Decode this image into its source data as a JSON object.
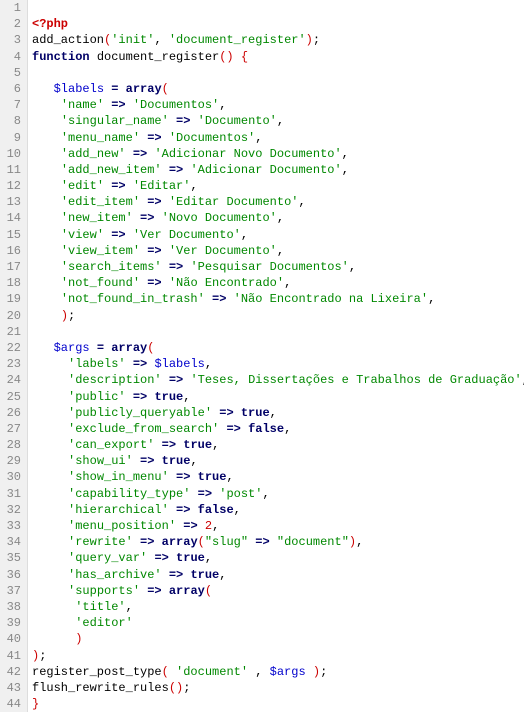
{
  "line_start": 1,
  "line_end": 44,
  "tokens": [
    [],
    [
      {
        "t": "<?php",
        "c": "tag"
      }
    ],
    [
      {
        "t": "add_action",
        "c": "fn"
      },
      {
        "t": "(",
        "c": "paren"
      },
      {
        "t": "'init'",
        "c": "str"
      },
      {
        "t": ", ",
        "c": "plain"
      },
      {
        "t": "'document_register'",
        "c": "str"
      },
      {
        "t": ")",
        "c": "paren"
      },
      {
        "t": ";",
        "c": "plain"
      }
    ],
    [
      {
        "t": "function",
        "c": "kw"
      },
      {
        "t": " ",
        "c": "plain"
      },
      {
        "t": "document_register",
        "c": "fn"
      },
      {
        "t": "()",
        "c": "paren"
      },
      {
        "t": " ",
        "c": "plain"
      },
      {
        "t": "{",
        "c": "paren"
      }
    ],
    [],
    [
      {
        "t": "   ",
        "c": "plain"
      },
      {
        "t": "$labels",
        "c": "var"
      },
      {
        "t": " ",
        "c": "plain"
      },
      {
        "t": "=",
        "c": "op"
      },
      {
        "t": " ",
        "c": "plain"
      },
      {
        "t": "array",
        "c": "kw"
      },
      {
        "t": "(",
        "c": "paren"
      }
    ],
    [
      {
        "t": "    ",
        "c": "plain"
      },
      {
        "t": "'name'",
        "c": "str"
      },
      {
        "t": " ",
        "c": "plain"
      },
      {
        "t": "=>",
        "c": "op"
      },
      {
        "t": " ",
        "c": "plain"
      },
      {
        "t": "'Documentos'",
        "c": "str"
      },
      {
        "t": ",",
        "c": "plain"
      }
    ],
    [
      {
        "t": "    ",
        "c": "plain"
      },
      {
        "t": "'singular_name'",
        "c": "str"
      },
      {
        "t": " ",
        "c": "plain"
      },
      {
        "t": "=>",
        "c": "op"
      },
      {
        "t": " ",
        "c": "plain"
      },
      {
        "t": "'Documento'",
        "c": "str"
      },
      {
        "t": ",",
        "c": "plain"
      }
    ],
    [
      {
        "t": "    ",
        "c": "plain"
      },
      {
        "t": "'menu_name'",
        "c": "str"
      },
      {
        "t": " ",
        "c": "plain"
      },
      {
        "t": "=>",
        "c": "op"
      },
      {
        "t": " ",
        "c": "plain"
      },
      {
        "t": "'Documentos'",
        "c": "str"
      },
      {
        "t": ",",
        "c": "plain"
      }
    ],
    [
      {
        "t": "    ",
        "c": "plain"
      },
      {
        "t": "'add_new'",
        "c": "str"
      },
      {
        "t": " ",
        "c": "plain"
      },
      {
        "t": "=>",
        "c": "op"
      },
      {
        "t": " ",
        "c": "plain"
      },
      {
        "t": "'Adicionar Novo Documento'",
        "c": "str"
      },
      {
        "t": ",",
        "c": "plain"
      }
    ],
    [
      {
        "t": "    ",
        "c": "plain"
      },
      {
        "t": "'add_new_item'",
        "c": "str"
      },
      {
        "t": " ",
        "c": "plain"
      },
      {
        "t": "=>",
        "c": "op"
      },
      {
        "t": " ",
        "c": "plain"
      },
      {
        "t": "'Adicionar Documento'",
        "c": "str"
      },
      {
        "t": ",",
        "c": "plain"
      }
    ],
    [
      {
        "t": "    ",
        "c": "plain"
      },
      {
        "t": "'edit'",
        "c": "str"
      },
      {
        "t": " ",
        "c": "plain"
      },
      {
        "t": "=>",
        "c": "op"
      },
      {
        "t": " ",
        "c": "plain"
      },
      {
        "t": "'Editar'",
        "c": "str"
      },
      {
        "t": ",",
        "c": "plain"
      }
    ],
    [
      {
        "t": "    ",
        "c": "plain"
      },
      {
        "t": "'edit_item'",
        "c": "str"
      },
      {
        "t": " ",
        "c": "plain"
      },
      {
        "t": "=>",
        "c": "op"
      },
      {
        "t": " ",
        "c": "plain"
      },
      {
        "t": "'Editar Documento'",
        "c": "str"
      },
      {
        "t": ",",
        "c": "plain"
      }
    ],
    [
      {
        "t": "    ",
        "c": "plain"
      },
      {
        "t": "'new_item'",
        "c": "str"
      },
      {
        "t": " ",
        "c": "plain"
      },
      {
        "t": "=>",
        "c": "op"
      },
      {
        "t": " ",
        "c": "plain"
      },
      {
        "t": "'Novo Documento'",
        "c": "str"
      },
      {
        "t": ",",
        "c": "plain"
      }
    ],
    [
      {
        "t": "    ",
        "c": "plain"
      },
      {
        "t": "'view'",
        "c": "str"
      },
      {
        "t": " ",
        "c": "plain"
      },
      {
        "t": "=>",
        "c": "op"
      },
      {
        "t": " ",
        "c": "plain"
      },
      {
        "t": "'Ver Documento'",
        "c": "str"
      },
      {
        "t": ",",
        "c": "plain"
      }
    ],
    [
      {
        "t": "    ",
        "c": "plain"
      },
      {
        "t": "'view_item'",
        "c": "str"
      },
      {
        "t": " ",
        "c": "plain"
      },
      {
        "t": "=>",
        "c": "op"
      },
      {
        "t": " ",
        "c": "plain"
      },
      {
        "t": "'Ver Documento'",
        "c": "str"
      },
      {
        "t": ",",
        "c": "plain"
      }
    ],
    [
      {
        "t": "    ",
        "c": "plain"
      },
      {
        "t": "'search_items'",
        "c": "str"
      },
      {
        "t": " ",
        "c": "plain"
      },
      {
        "t": "=>",
        "c": "op"
      },
      {
        "t": " ",
        "c": "plain"
      },
      {
        "t": "'Pesquisar Documentos'",
        "c": "str"
      },
      {
        "t": ",",
        "c": "plain"
      }
    ],
    [
      {
        "t": "    ",
        "c": "plain"
      },
      {
        "t": "'not_found'",
        "c": "str"
      },
      {
        "t": " ",
        "c": "plain"
      },
      {
        "t": "=>",
        "c": "op"
      },
      {
        "t": " ",
        "c": "plain"
      },
      {
        "t": "'Não Encontrado'",
        "c": "str"
      },
      {
        "t": ",",
        "c": "plain"
      }
    ],
    [
      {
        "t": "    ",
        "c": "plain"
      },
      {
        "t": "'not_found_in_trash'",
        "c": "str"
      },
      {
        "t": " ",
        "c": "plain"
      },
      {
        "t": "=>",
        "c": "op"
      },
      {
        "t": " ",
        "c": "plain"
      },
      {
        "t": "'Não Encontrado na Lixeira'",
        "c": "str"
      },
      {
        "t": ",",
        "c": "plain"
      }
    ],
    [
      {
        "t": "    ",
        "c": "plain"
      },
      {
        "t": ")",
        "c": "paren"
      },
      {
        "t": ";",
        "c": "plain"
      }
    ],
    [],
    [
      {
        "t": "   ",
        "c": "plain"
      },
      {
        "t": "$args",
        "c": "var"
      },
      {
        "t": " ",
        "c": "plain"
      },
      {
        "t": "=",
        "c": "op"
      },
      {
        "t": " ",
        "c": "plain"
      },
      {
        "t": "array",
        "c": "kw"
      },
      {
        "t": "(",
        "c": "paren"
      }
    ],
    [
      {
        "t": "     ",
        "c": "plain"
      },
      {
        "t": "'labels'",
        "c": "str"
      },
      {
        "t": " ",
        "c": "plain"
      },
      {
        "t": "=>",
        "c": "op"
      },
      {
        "t": " ",
        "c": "plain"
      },
      {
        "t": "$labels",
        "c": "var"
      },
      {
        "t": ",",
        "c": "plain"
      }
    ],
    [
      {
        "t": "     ",
        "c": "plain"
      },
      {
        "t": "'description'",
        "c": "str"
      },
      {
        "t": " ",
        "c": "plain"
      },
      {
        "t": "=>",
        "c": "op"
      },
      {
        "t": " ",
        "c": "plain"
      },
      {
        "t": "'Teses, Dissertações e Trabalhos de Graduação'",
        "c": "str"
      },
      {
        "t": ",",
        "c": "plain"
      }
    ],
    [
      {
        "t": "     ",
        "c": "plain"
      },
      {
        "t": "'public'",
        "c": "str"
      },
      {
        "t": " ",
        "c": "plain"
      },
      {
        "t": "=>",
        "c": "op"
      },
      {
        "t": " ",
        "c": "plain"
      },
      {
        "t": "true",
        "c": "bool"
      },
      {
        "t": ",",
        "c": "plain"
      }
    ],
    [
      {
        "t": "     ",
        "c": "plain"
      },
      {
        "t": "'publicly_queryable'",
        "c": "str"
      },
      {
        "t": " ",
        "c": "plain"
      },
      {
        "t": "=>",
        "c": "op"
      },
      {
        "t": " ",
        "c": "plain"
      },
      {
        "t": "true",
        "c": "bool"
      },
      {
        "t": ",",
        "c": "plain"
      }
    ],
    [
      {
        "t": "     ",
        "c": "plain"
      },
      {
        "t": "'exclude_from_search'",
        "c": "str"
      },
      {
        "t": " ",
        "c": "plain"
      },
      {
        "t": "=>",
        "c": "op"
      },
      {
        "t": " ",
        "c": "plain"
      },
      {
        "t": "false",
        "c": "bool"
      },
      {
        "t": ",",
        "c": "plain"
      }
    ],
    [
      {
        "t": "     ",
        "c": "plain"
      },
      {
        "t": "'can_export'",
        "c": "str"
      },
      {
        "t": " ",
        "c": "plain"
      },
      {
        "t": "=>",
        "c": "op"
      },
      {
        "t": " ",
        "c": "plain"
      },
      {
        "t": "true",
        "c": "bool"
      },
      {
        "t": ",",
        "c": "plain"
      }
    ],
    [
      {
        "t": "     ",
        "c": "plain"
      },
      {
        "t": "'show_ui'",
        "c": "str"
      },
      {
        "t": " ",
        "c": "plain"
      },
      {
        "t": "=>",
        "c": "op"
      },
      {
        "t": " ",
        "c": "plain"
      },
      {
        "t": "true",
        "c": "bool"
      },
      {
        "t": ",",
        "c": "plain"
      }
    ],
    [
      {
        "t": "     ",
        "c": "plain"
      },
      {
        "t": "'show_in_menu'",
        "c": "str"
      },
      {
        "t": " ",
        "c": "plain"
      },
      {
        "t": "=>",
        "c": "op"
      },
      {
        "t": " ",
        "c": "plain"
      },
      {
        "t": "true",
        "c": "bool"
      },
      {
        "t": ",",
        "c": "plain"
      }
    ],
    [
      {
        "t": "     ",
        "c": "plain"
      },
      {
        "t": "'capability_type'",
        "c": "str"
      },
      {
        "t": " ",
        "c": "plain"
      },
      {
        "t": "=>",
        "c": "op"
      },
      {
        "t": " ",
        "c": "plain"
      },
      {
        "t": "'post'",
        "c": "str"
      },
      {
        "t": ",",
        "c": "plain"
      }
    ],
    [
      {
        "t": "     ",
        "c": "plain"
      },
      {
        "t": "'hierarchical'",
        "c": "str"
      },
      {
        "t": " ",
        "c": "plain"
      },
      {
        "t": "=>",
        "c": "op"
      },
      {
        "t": " ",
        "c": "plain"
      },
      {
        "t": "false",
        "c": "bool"
      },
      {
        "t": ",",
        "c": "plain"
      }
    ],
    [
      {
        "t": "     ",
        "c": "plain"
      },
      {
        "t": "'menu_position'",
        "c": "str"
      },
      {
        "t": " ",
        "c": "plain"
      },
      {
        "t": "=>",
        "c": "op"
      },
      {
        "t": " ",
        "c": "plain"
      },
      {
        "t": "2",
        "c": "num"
      },
      {
        "t": ",",
        "c": "plain"
      }
    ],
    [
      {
        "t": "     ",
        "c": "plain"
      },
      {
        "t": "'rewrite'",
        "c": "str"
      },
      {
        "t": " ",
        "c": "plain"
      },
      {
        "t": "=>",
        "c": "op"
      },
      {
        "t": " ",
        "c": "plain"
      },
      {
        "t": "array",
        "c": "kw"
      },
      {
        "t": "(",
        "c": "paren"
      },
      {
        "t": "\"slug\"",
        "c": "str"
      },
      {
        "t": " ",
        "c": "plain"
      },
      {
        "t": "=>",
        "c": "op"
      },
      {
        "t": " ",
        "c": "plain"
      },
      {
        "t": "\"document\"",
        "c": "str"
      },
      {
        "t": ")",
        "c": "paren"
      },
      {
        "t": ",",
        "c": "plain"
      }
    ],
    [
      {
        "t": "     ",
        "c": "plain"
      },
      {
        "t": "'query_var'",
        "c": "str"
      },
      {
        "t": " ",
        "c": "plain"
      },
      {
        "t": "=>",
        "c": "op"
      },
      {
        "t": " ",
        "c": "plain"
      },
      {
        "t": "true",
        "c": "bool"
      },
      {
        "t": ",",
        "c": "plain"
      }
    ],
    [
      {
        "t": "     ",
        "c": "plain"
      },
      {
        "t": "'has_archive'",
        "c": "str"
      },
      {
        "t": " ",
        "c": "plain"
      },
      {
        "t": "=>",
        "c": "op"
      },
      {
        "t": " ",
        "c": "plain"
      },
      {
        "t": "true",
        "c": "bool"
      },
      {
        "t": ",",
        "c": "plain"
      }
    ],
    [
      {
        "t": "     ",
        "c": "plain"
      },
      {
        "t": "'supports'",
        "c": "str"
      },
      {
        "t": " ",
        "c": "plain"
      },
      {
        "t": "=>",
        "c": "op"
      },
      {
        "t": " ",
        "c": "plain"
      },
      {
        "t": "array",
        "c": "kw"
      },
      {
        "t": "(",
        "c": "paren"
      }
    ],
    [
      {
        "t": "      ",
        "c": "plain"
      },
      {
        "t": "'title'",
        "c": "str"
      },
      {
        "t": ",",
        "c": "plain"
      }
    ],
    [
      {
        "t": "      ",
        "c": "plain"
      },
      {
        "t": "'editor'",
        "c": "str"
      }
    ],
    [
      {
        "t": "      ",
        "c": "plain"
      },
      {
        "t": ")",
        "c": "paren"
      }
    ],
    [
      {
        "t": ")",
        "c": "paren"
      },
      {
        "t": ";",
        "c": "plain"
      }
    ],
    [
      {
        "t": "register_post_type",
        "c": "fn"
      },
      {
        "t": "(",
        "c": "paren"
      },
      {
        "t": " ",
        "c": "plain"
      },
      {
        "t": "'document'",
        "c": "str"
      },
      {
        "t": " , ",
        "c": "plain"
      },
      {
        "t": "$args",
        "c": "var"
      },
      {
        "t": " ",
        "c": "plain"
      },
      {
        "t": ")",
        "c": "paren"
      },
      {
        "t": ";",
        "c": "plain"
      }
    ],
    [
      {
        "t": "flush_rewrite_rules",
        "c": "fn"
      },
      {
        "t": "()",
        "c": "paren"
      },
      {
        "t": ";",
        "c": "plain"
      }
    ],
    [
      {
        "t": "}",
        "c": "paren"
      }
    ]
  ]
}
